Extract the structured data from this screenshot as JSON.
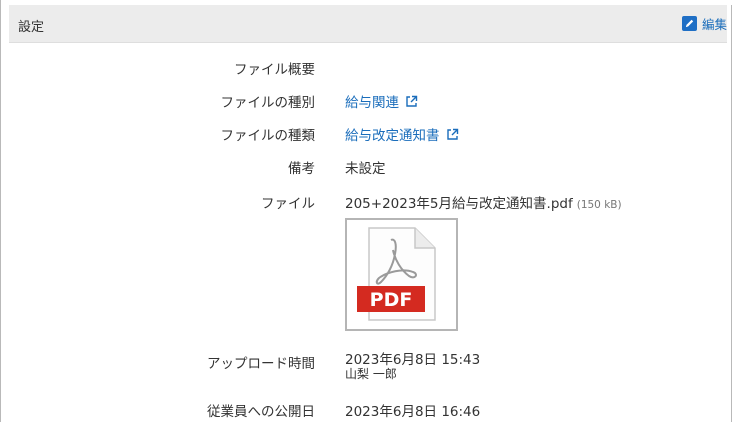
{
  "header": {
    "title": "設定",
    "edit_label": "編集"
  },
  "fields": {
    "overview_label": "ファイル概要",
    "type1_label": "ファイルの種別",
    "type1_value": "給与関連",
    "type2_label": "ファイルの種類",
    "type2_value": "給与改定通知書",
    "notes_label": "備考",
    "notes_value": "未設定",
    "file_label": "ファイル",
    "file_name": "205+2023年5月給与改定通知書.pdf",
    "file_size": "(150 kB)",
    "thumbnail_text": "PDF",
    "upload_label": "アップロード時間",
    "upload_time": "2023年6月8日 15:43",
    "uploader": "山梨 一郎",
    "publish_label": "従業員への公開日",
    "publish_time": "2023年6月8日 16:46"
  },
  "colors": {
    "link": "#1a6dbb",
    "header_bg": "#ececec",
    "pdf_red": "#d42a20"
  }
}
